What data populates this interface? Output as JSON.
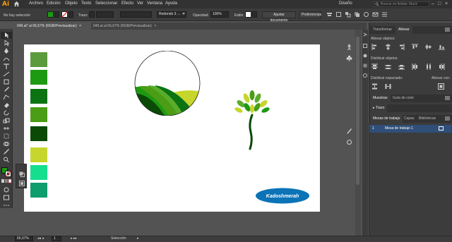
{
  "app": {
    "logo_text": "Ai"
  },
  "menu": {
    "items": [
      "Archivo",
      "Edición",
      "Objeto",
      "Texto",
      "Seleccionar",
      "Efecto",
      "Ver",
      "Ventana",
      "Ayuda"
    ],
    "workspace": "Diseño",
    "stock_search_placeholder": "Buscar en Adobe Stock"
  },
  "control_bar": {
    "selection_status": "No hay selección",
    "stroke_label": "Trazo",
    "brush_value": "Redondo 3 ...",
    "opacity_label": "Opacidad:",
    "opacity_value": "100%",
    "style_label": "Estilo:",
    "adjust_doc_label": "Ajustar documento",
    "preferences_label": "Preferencias",
    "fill_color": "#1c9a12"
  },
  "tabs": [
    {
      "label": "049.ai* al 66,67% (RGB/Previsualizar)",
      "close": "×"
    },
    {
      "label": "049.ai al 66,67% (RGB/Previsualizar)",
      "close": "×"
    }
  ],
  "artwork": {
    "swatches": [
      "#5b9a3d",
      "#1e9a12",
      "#0c7313",
      "#4a9d14",
      "#0a4a06",
      "#c6d62c",
      "#15de8f",
      "#0e9d6d"
    ],
    "badge_text": "Kadoshmerah"
  },
  "panels": {
    "top_tabs": [
      "Transformar",
      "Alinear"
    ],
    "align_objects": "Alinear objetos:",
    "distribute_objects": "Distribuir objetos:",
    "distribute_spacing": "Distribuir espaciado:",
    "align_with": "Alinear con:",
    "swatch_tabs": [
      "Muestras",
      "Guía de color"
    ],
    "stroke_tab": "Trazo",
    "layer_tabs": [
      "Mesas de trabajo",
      "Capas",
      "Bibliotecas"
    ],
    "artboards": [
      {
        "num": "1",
        "name": "Mesa de trabajo 1"
      }
    ]
  },
  "status_bar": {
    "zoom": "66,67%",
    "artboard_num": "1",
    "tool": "Selección"
  }
}
